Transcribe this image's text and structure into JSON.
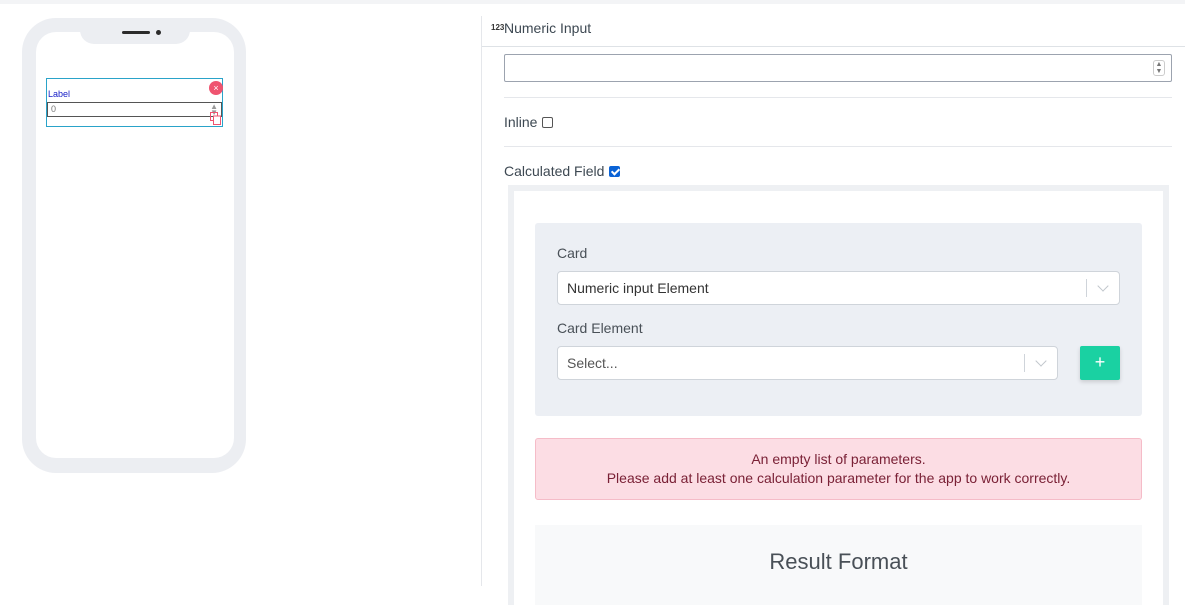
{
  "preview": {
    "field_label": "Label",
    "field_value": "0",
    "close_icon": "×",
    "spin_up": "▲",
    "spin_down": "▼"
  },
  "panel": {
    "icon_text": "123",
    "title": "Numeric Input",
    "numeric_input_value": "",
    "spin_up": "▲",
    "spin_down": "▼",
    "inline_label": "Inline",
    "inline_checked": false,
    "calculated_label": "Calculated Field",
    "calculated_checked": true
  },
  "calc": {
    "card_label": "Card",
    "card_value": "Numeric input Element",
    "card_element_label": "Card Element",
    "card_element_placeholder": "Select...",
    "add_button": "+",
    "alert_line1": "An empty list of parameters.",
    "alert_line2": "Please add at least one calculation parameter for the app to work correctly.",
    "result_title": "Result Format"
  },
  "colors": {
    "accent": "#1ad1a2",
    "checkbox": "#0b63d6",
    "alert_bg": "#fcdde4",
    "close": "#ef5470"
  }
}
